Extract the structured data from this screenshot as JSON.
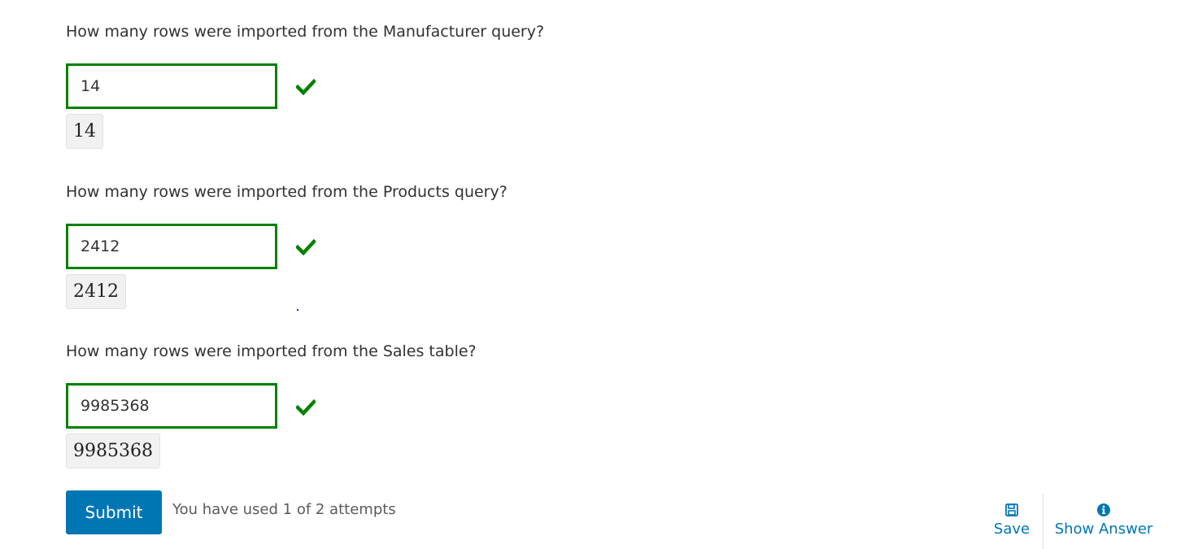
{
  "questions": [
    {
      "text": "How many rows were imported from the Manufacturer query?",
      "value": "14",
      "preview": "14",
      "status_icon": "checkmark-icon",
      "status_color": "#008100"
    },
    {
      "text": "How many rows were imported from the Products query?",
      "value": "2412",
      "preview": "2412",
      "status_icon": "checkmark-icon",
      "status_color": "#008100"
    },
    {
      "text": "How many rows were imported from the Sales table?",
      "value": "9985368",
      "preview": "9985368",
      "status_icon": "checkmark-icon",
      "status_color": "#008100"
    }
  ],
  "footer": {
    "submit_label": "Submit",
    "attempts_text": "You have used 1 of 2 attempts",
    "save_label": "Save",
    "save_icon": "floppy-disk-icon",
    "show_answer_label": "Show Answer",
    "show_answer_icon": "info-circle-icon"
  },
  "colors": {
    "correct": "#008100",
    "accent": "#0075b4"
  }
}
